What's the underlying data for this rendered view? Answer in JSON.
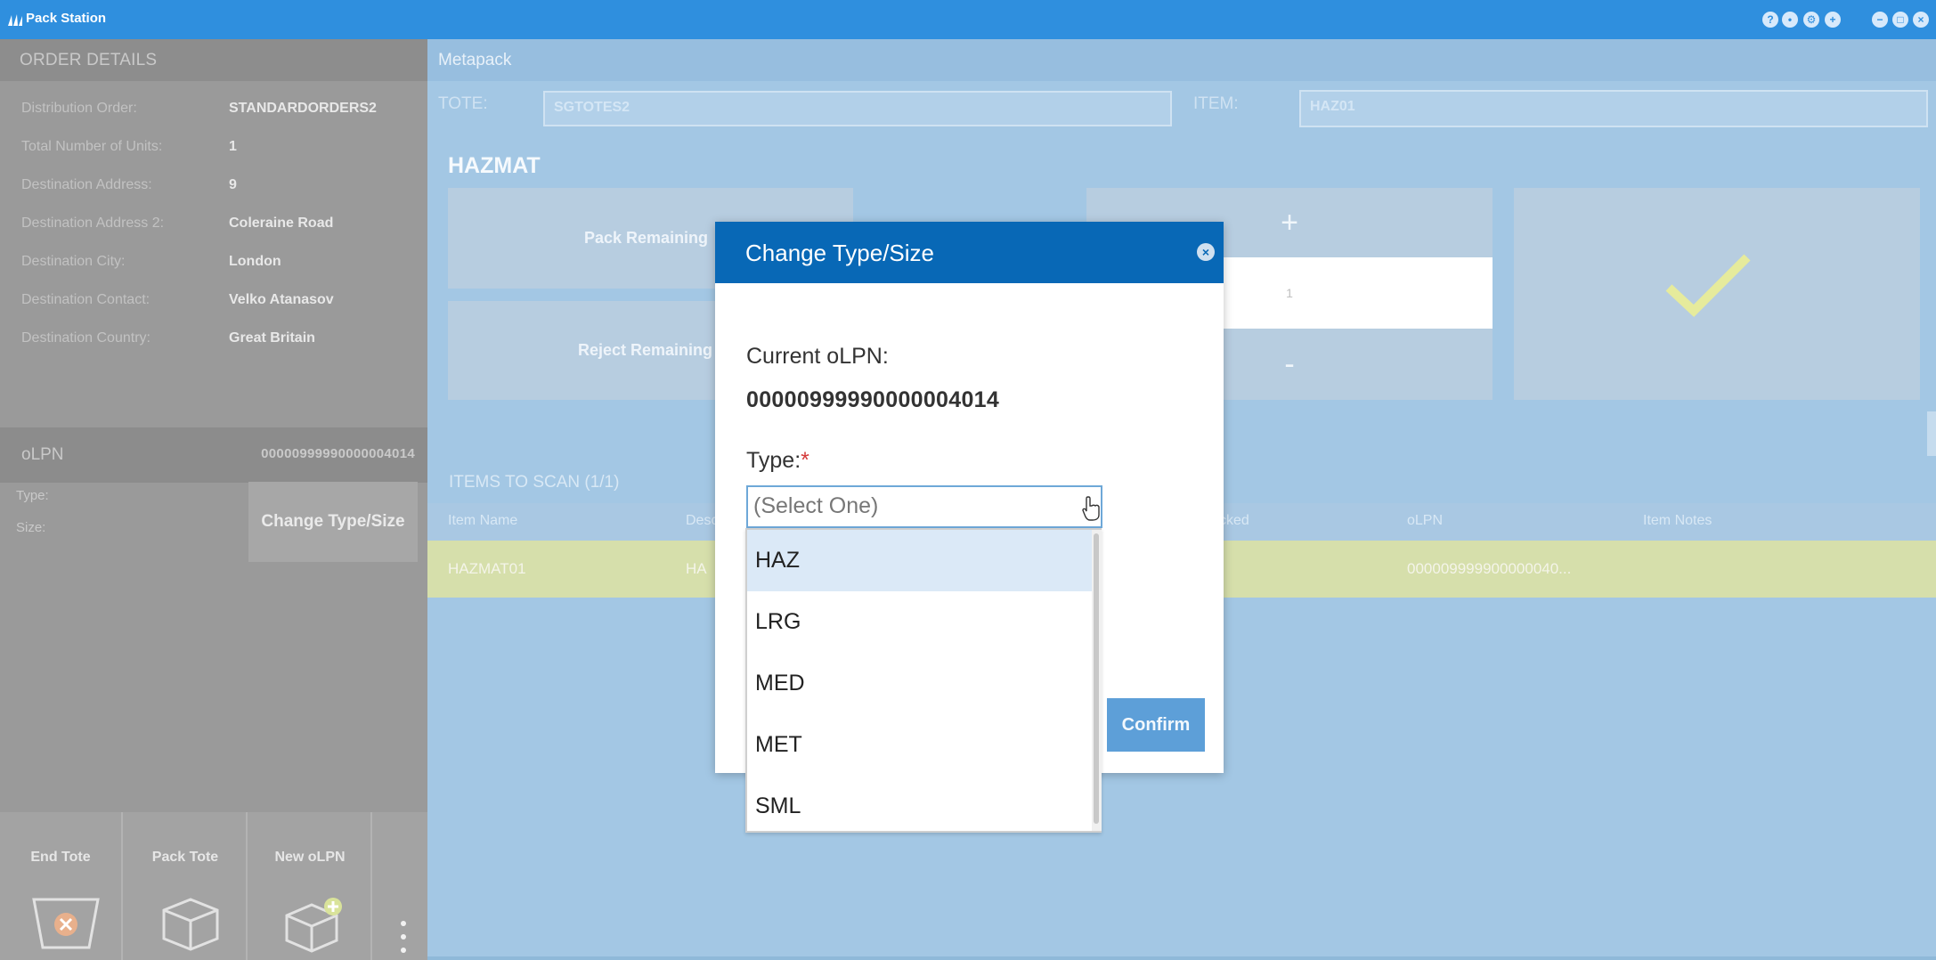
{
  "window": {
    "title": "Pack Station"
  },
  "order_details": {
    "header": "ORDER DETAILS",
    "rows": [
      {
        "label": "Distribution Order:",
        "value": "STANDARDORDERS2"
      },
      {
        "label": "Total Number of Units:",
        "value": "1"
      },
      {
        "label": "Destination Address:",
        "value": "9"
      },
      {
        "label": "Destination Address 2:",
        "value": "Coleraine Road"
      },
      {
        "label": "Destination City:",
        "value": "London"
      },
      {
        "label": "Destination Contact:",
        "value": "Velko Atanasov"
      },
      {
        "label": "Destination Country:",
        "value": "Great Britain"
      }
    ],
    "olpn_label": "oLPN",
    "olpn_value": "00000999990000004014",
    "type_label": "Type:",
    "size_label": "Size:",
    "change_type_size_button": "Change Type/Size"
  },
  "bottom_actions": {
    "end_tote": "End Tote",
    "pack_tote": "Pack Tote",
    "new_olpn": "New oLPN"
  },
  "main": {
    "header": "Metapack",
    "tote_label": "TOTE:",
    "tote_value": "SGTOTES2",
    "item_label": "ITEM:",
    "item_value": "HAZ01",
    "section_title": "HAZMAT",
    "pack_remaining": "Pack Remaining",
    "reject_remaining": "Reject Remaining",
    "stepper_plus": "+",
    "stepper_value": "1",
    "stepper_minus": "-",
    "items_to_scan_title": "ITEMS TO SCAN (1/1)",
    "table_columns": [
      "Item Name",
      "Desc",
      "cked",
      "oLPN",
      "Item Notes"
    ],
    "table_row": [
      "HAZMAT01",
      "HA",
      "",
      "000009999900000040...",
      ""
    ]
  },
  "dialog": {
    "title": "Change Type/Size",
    "current_olpn_label": "Current oLPN:",
    "current_olpn_value": "00000999990000004014",
    "type_label": "Type:",
    "required_marker": "*",
    "select_placeholder": "(Select One)",
    "confirm_button": "Confirm",
    "type_options": [
      "HAZ",
      "LRG",
      "MED",
      "MET",
      "SML"
    ],
    "highlighted_option": "HAZ"
  },
  "colors": {
    "titlebar": "#2f8fde",
    "dialog_header": "#0868b6",
    "highlight_row": "#d6dfab"
  }
}
